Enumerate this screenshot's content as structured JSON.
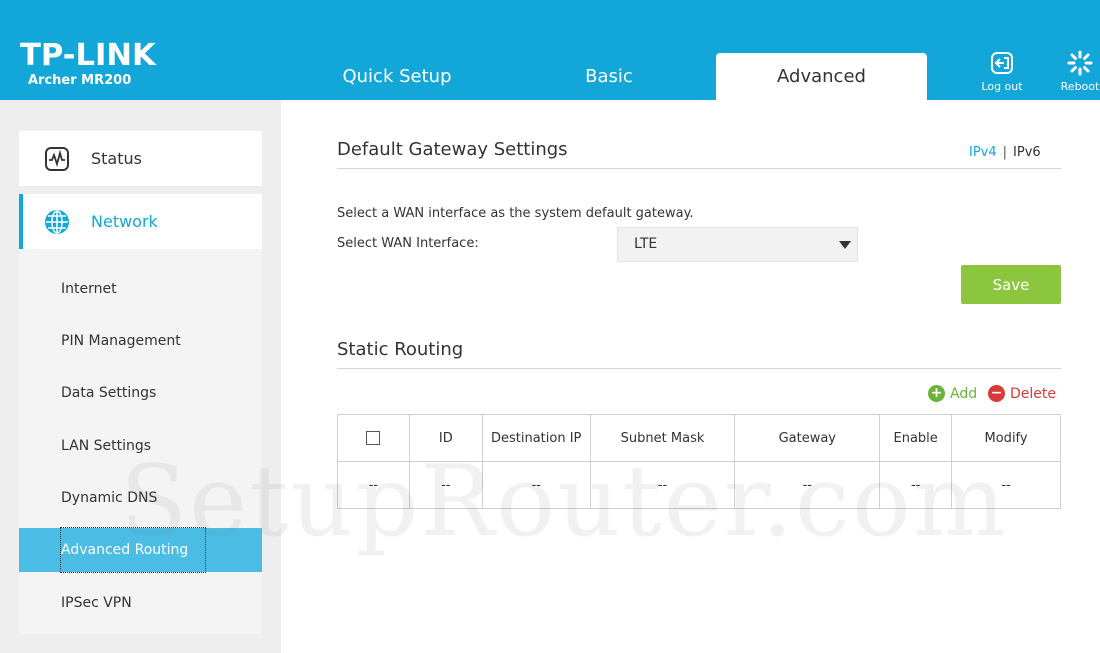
{
  "header": {
    "brand": "TP-LINK",
    "model": "Archer MR200",
    "tabs": [
      {
        "label": "Quick Setup"
      },
      {
        "label": "Basic"
      },
      {
        "label": "Advanced",
        "active": true
      }
    ],
    "logout_label": "Log out",
    "reboot_label": "Reboot"
  },
  "sidebar": {
    "main_items": [
      {
        "label": "Status",
        "icon": "pulse-icon"
      },
      {
        "label": "Network",
        "icon": "globe-icon",
        "active": true
      }
    ],
    "sub_items": [
      {
        "label": "Internet"
      },
      {
        "label": "PIN Management"
      },
      {
        "label": "Data Settings"
      },
      {
        "label": "LAN Settings"
      },
      {
        "label": "Dynamic DNS"
      },
      {
        "label": "Advanced Routing",
        "active": true
      },
      {
        "label": "IPSec VPN"
      }
    ]
  },
  "gateway": {
    "title": "Default Gateway Settings",
    "ipv4": "IPv4",
    "sep": "|",
    "ipv6": "IPv6",
    "description": "Select a WAN interface as the system default gateway.",
    "interface_label": "Select WAN Interface:",
    "interface_value": "LTE",
    "save_label": "Save"
  },
  "static_routing": {
    "title": "Static Routing",
    "add_label": "Add",
    "delete_label": "Delete",
    "columns": [
      "ID",
      "Destination IP",
      "Subnet Mask",
      "Gateway",
      "Enable",
      "Modify"
    ],
    "rows": [
      [
        "--",
        "--",
        "--",
        "--",
        "--",
        "--",
        "--"
      ]
    ]
  },
  "watermark": "SetupRouter.com",
  "colors": {
    "header_blue": "#12a6d9",
    "active_sub": "#4bbde5",
    "save_green": "#8cc63e",
    "add_green": "#6bb43a",
    "delete_red": "#d83a3a"
  }
}
